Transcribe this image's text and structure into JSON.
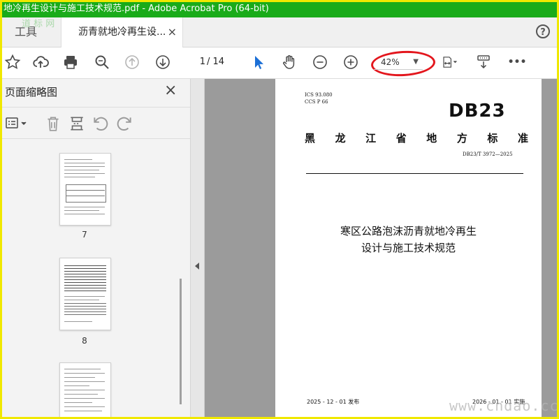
{
  "window": {
    "title": "地冷再生设计与施工技术规范.pdf - Adobe Acrobat Pro (64-bit)"
  },
  "tabs": {
    "tools_label": "工具",
    "document_label": "沥青就地冷再生设...",
    "close_glyph": "×"
  },
  "help_glyph": "?",
  "toolbar": {
    "page_current": "1",
    "page_total": "/ 14",
    "zoom_value": "42%",
    "zoom_caret": "▼",
    "more_glyph": "•••",
    "annotation_color": "#e3161d"
  },
  "sidepanel": {
    "title": "页面缩略图",
    "close_glyph": "×",
    "thumbnails": [
      {
        "label": "7"
      },
      {
        "label": "8"
      },
      {
        "label": ""
      }
    ]
  },
  "pdf_page": {
    "ics": "ICS  93.080",
    "ccs": "CCS  P 66",
    "db_code": "DB23",
    "province_chars": [
      "黑",
      "龙",
      "江",
      "省",
      "地",
      "方",
      "标",
      "准"
    ],
    "standard_number": "DB23/T 3972—2025",
    "title_line1": "寒区公路泡沫沥青就地冷再生",
    "title_line2": "设计与施工技术规范",
    "publish_date": "2025 - 12 - 01 发布",
    "implement_date": "2026 - 01 - 01 实施"
  },
  "watermarks": {
    "top_left": "道 标 网",
    "bottom_right": "www.cndao.cc"
  },
  "colors": {
    "titlebar": "#1aab1a",
    "frame": "#f0e800",
    "viewer_bg": "#9b9b9b",
    "cursor": "#1b6fd6"
  }
}
